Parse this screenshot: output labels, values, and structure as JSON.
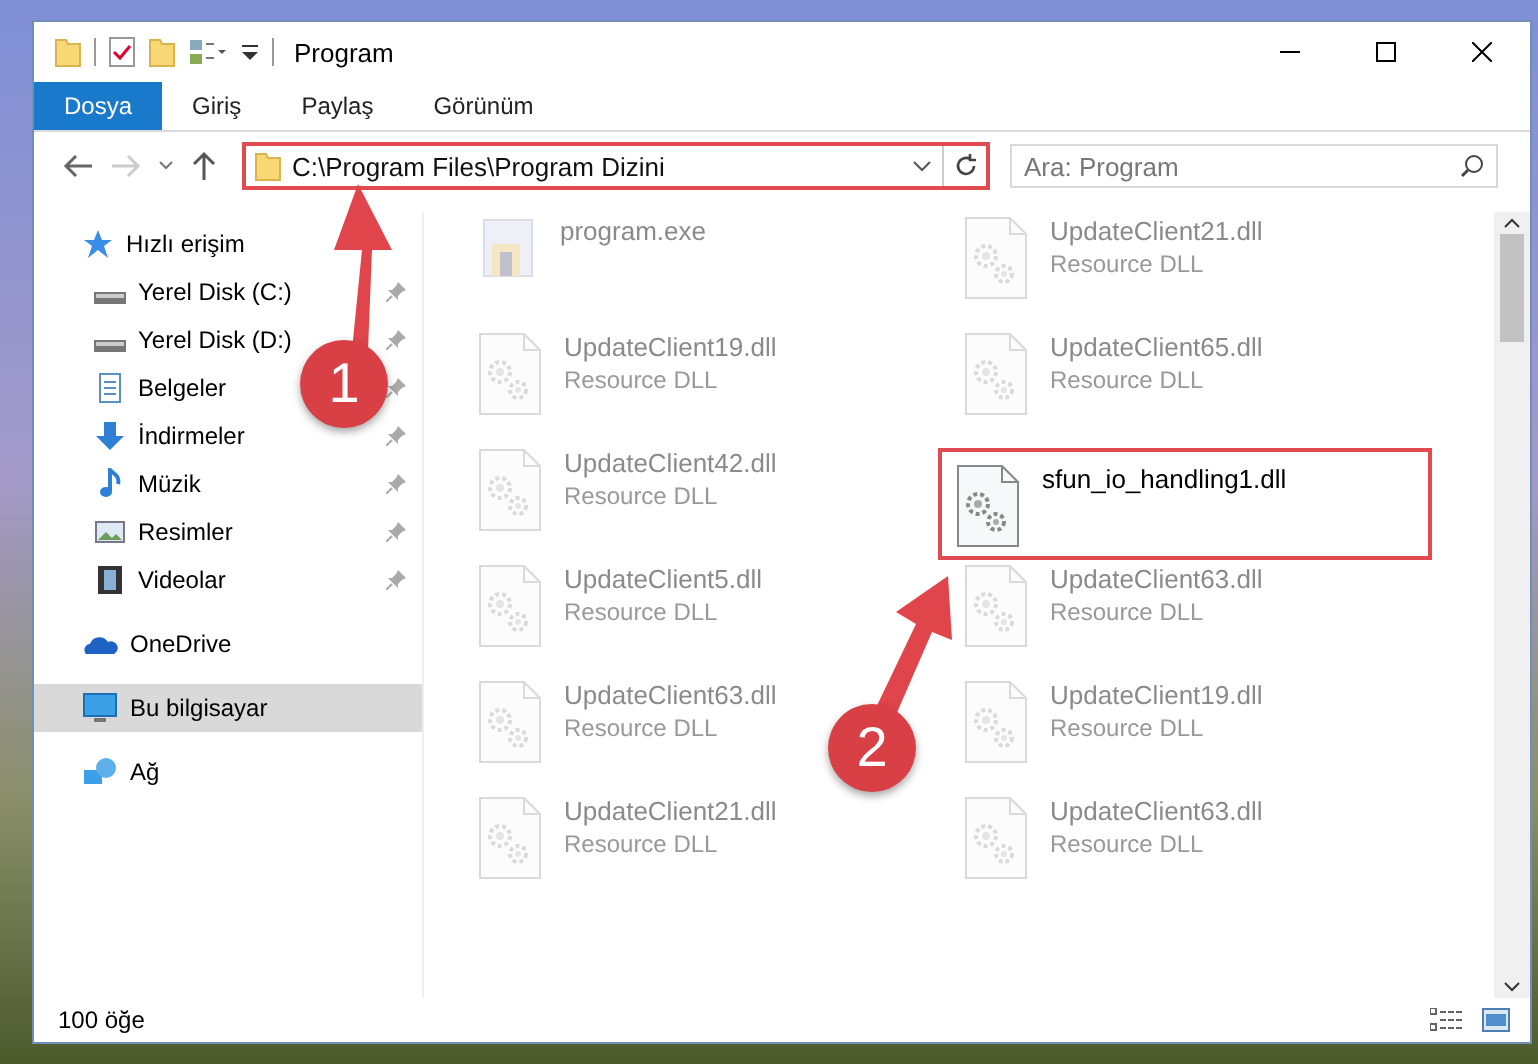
{
  "window": {
    "title": "Program"
  },
  "ribbon_tabs": [
    {
      "label": "Dosya",
      "selected": true
    },
    {
      "label": "Giriş",
      "selected": false
    },
    {
      "label": "Paylaş",
      "selected": false
    },
    {
      "label": "Görünüm",
      "selected": false
    }
  ],
  "address_bar": {
    "value": "C:\\Program Files\\Program Dizini"
  },
  "search": {
    "placeholder": "Ara: Program"
  },
  "sidebar": {
    "items": [
      {
        "label": "Hızlı erişim",
        "kind": "star",
        "selected": false,
        "children": [
          {
            "label": "Yerel Disk (C:)",
            "kind": "drive",
            "pinned": true,
            "selected": false
          },
          {
            "label": "Yerel Disk (D:)",
            "kind": "drive",
            "pinned": true,
            "selected": false
          },
          {
            "label": "Belgeler",
            "kind": "document",
            "pinned": true,
            "selected": false
          },
          {
            "label": "İndirmeler",
            "kind": "download",
            "pinned": true,
            "selected": false
          },
          {
            "label": "Müzik",
            "kind": "music",
            "pinned": true,
            "selected": false
          },
          {
            "label": "Resimler",
            "kind": "picture",
            "pinned": true,
            "selected": false
          },
          {
            "label": "Videolar",
            "kind": "video",
            "pinned": true,
            "selected": false
          }
        ]
      },
      {
        "label": "OneDrive",
        "kind": "cloud",
        "selected": false
      },
      {
        "label": "Bu bilgisayar",
        "kind": "computer",
        "selected": true
      },
      {
        "label": "Ağ",
        "kind": "network",
        "selected": false
      }
    ]
  },
  "files": [
    {
      "name": "program.exe",
      "kind": "exe",
      "highlighted": false
    },
    {
      "name": "UpdateClient21.dll",
      "subtitle": "Resource DLL",
      "kind": "dll",
      "highlighted": false
    },
    {
      "name": "UpdateClient19.dll",
      "subtitle": "Resource DLL",
      "kind": "dll",
      "highlighted": false
    },
    {
      "name": "UpdateClient65.dll",
      "subtitle": "Resource DLL",
      "kind": "dll",
      "highlighted": false
    },
    {
      "name": "UpdateClient42.dll",
      "subtitle": "Resource DLL",
      "kind": "dll",
      "highlighted": false
    },
    {
      "name": "sfun_io_handling1.dll",
      "kind": "dll",
      "highlighted": true
    },
    {
      "name": "UpdateClient5.dll",
      "subtitle": "Resource DLL",
      "kind": "dll",
      "highlighted": false
    },
    {
      "name": "UpdateClient63.dll",
      "subtitle": "Resource DLL",
      "kind": "dll",
      "highlighted": false
    },
    {
      "name": "UpdateClient63.dll",
      "subtitle": "Resource DLL",
      "kind": "dll",
      "highlighted": false
    },
    {
      "name": "UpdateClient19.dll",
      "subtitle": "Resource DLL",
      "kind": "dll",
      "highlighted": false
    },
    {
      "name": "UpdateClient21.dll",
      "subtitle": "Resource DLL",
      "kind": "dll",
      "highlighted": false
    },
    {
      "name": "UpdateClient63.dll",
      "subtitle": "Resource DLL",
      "kind": "dll",
      "highlighted": false
    }
  ],
  "status_bar": {
    "item_count": "100 öğe"
  },
  "annotations": [
    {
      "number": "1"
    },
    {
      "number": "2"
    }
  ]
}
